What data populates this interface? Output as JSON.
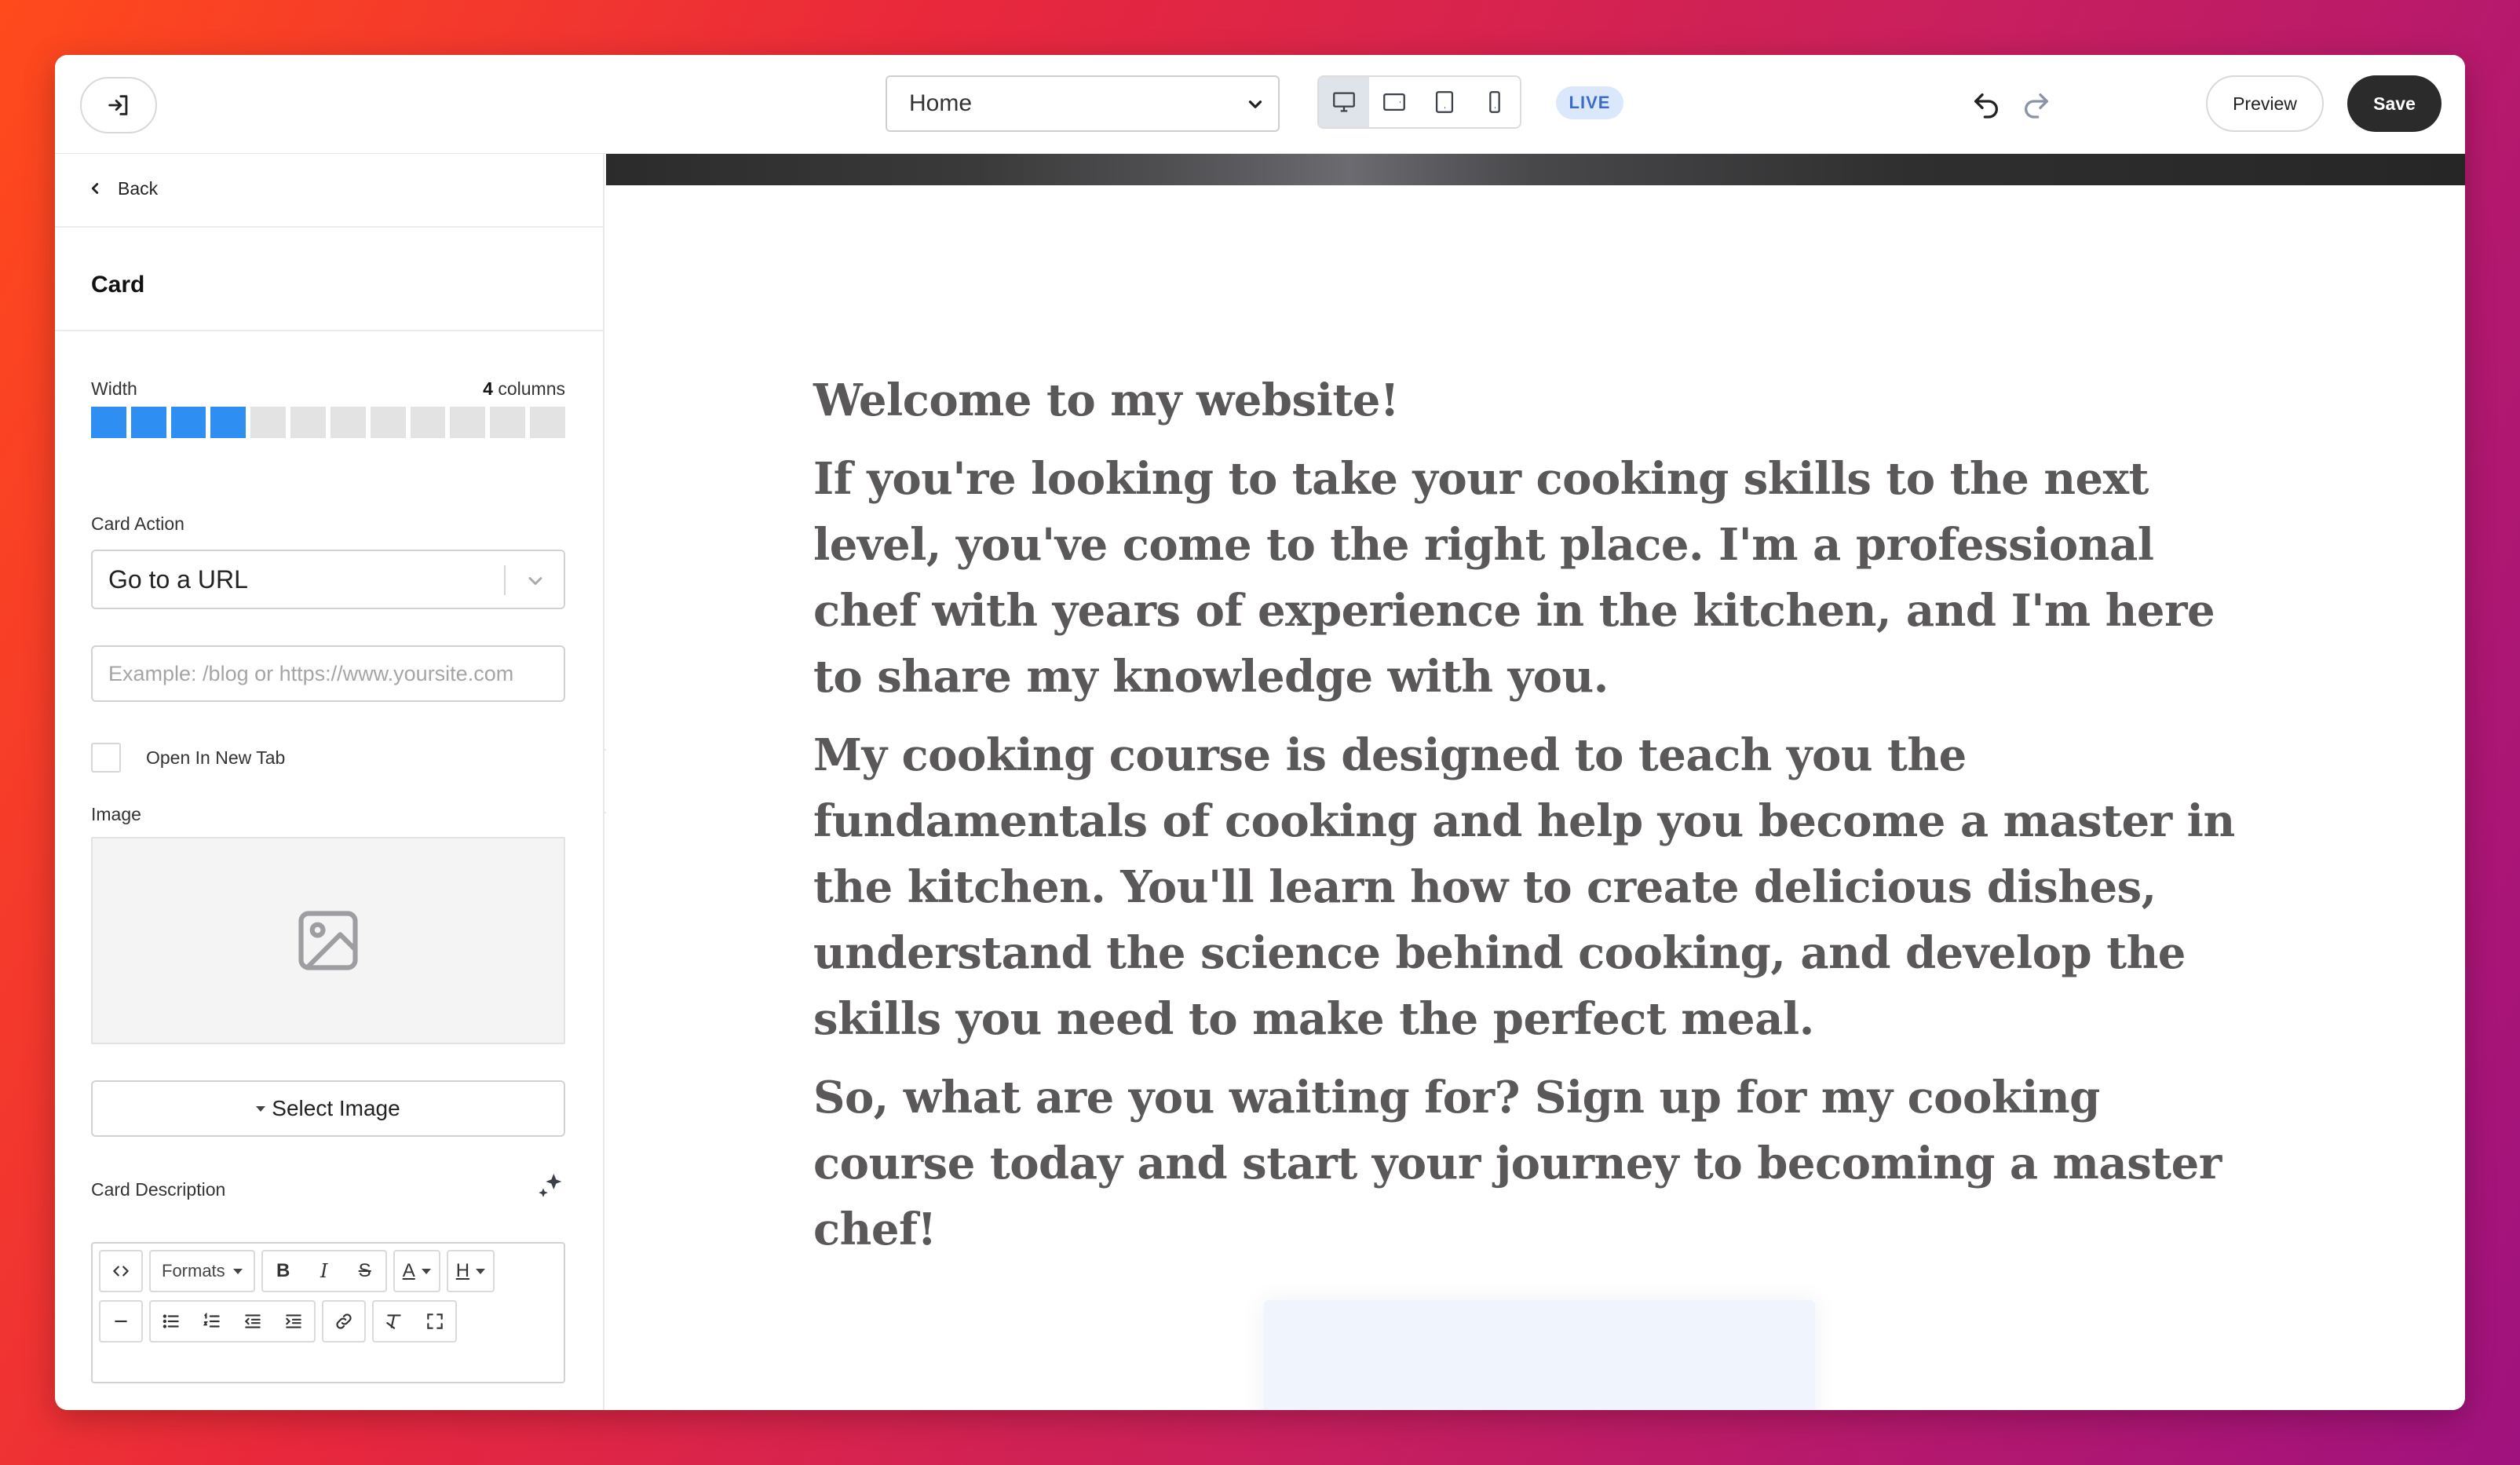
{
  "topbar": {
    "page_select_value": "Home",
    "live_badge": "LIVE",
    "preview_label": "Preview",
    "save_label": "Save"
  },
  "sidebar": {
    "back_label": "Back",
    "title": "Card",
    "width": {
      "label": "Width",
      "value_number": "4",
      "value_unit": "columns",
      "selected_columns": 4,
      "total_columns": 12
    },
    "card_action": {
      "label": "Card Action",
      "selected": "Go to a URL"
    },
    "url_input": {
      "placeholder": "Example: /blog or https://www.yoursite.com",
      "value": ""
    },
    "open_new_tab_label": "Open In New Tab",
    "image_label": "Image",
    "select_image_label": "Select Image",
    "card_description_label": "Card Description",
    "editor": {
      "formats_label": "Formats",
      "bold": "B",
      "italic": "I",
      "strike": "S",
      "font_color": "A",
      "heading": "H"
    }
  },
  "canvas": {
    "heading": "Welcome to my website!",
    "paragraphs": [
      "If you're looking to take your cooking skills to the next level, you've come to the right place. I'm a professional chef with years of experience in the kitchen, and I'm here to share my knowledge with you.",
      "My cooking course is designed to teach you the fundamentals of cooking and help you become a master in the kitchen. You'll learn how to create delicious dishes, understand the science behind cooking, and develop the skills you need to make the perfect meal.",
      "So, what are you waiting for? Sign up for my cooking course today and start your journey to becoming a master chef!"
    ]
  },
  "colors": {
    "accent_blue": "#2f8ef2",
    "save_button": "#2b2b2b",
    "live_badge_bg": "#dbe7fb",
    "live_badge_text": "#3b6cc9",
    "body_text": "#5a5858"
  }
}
